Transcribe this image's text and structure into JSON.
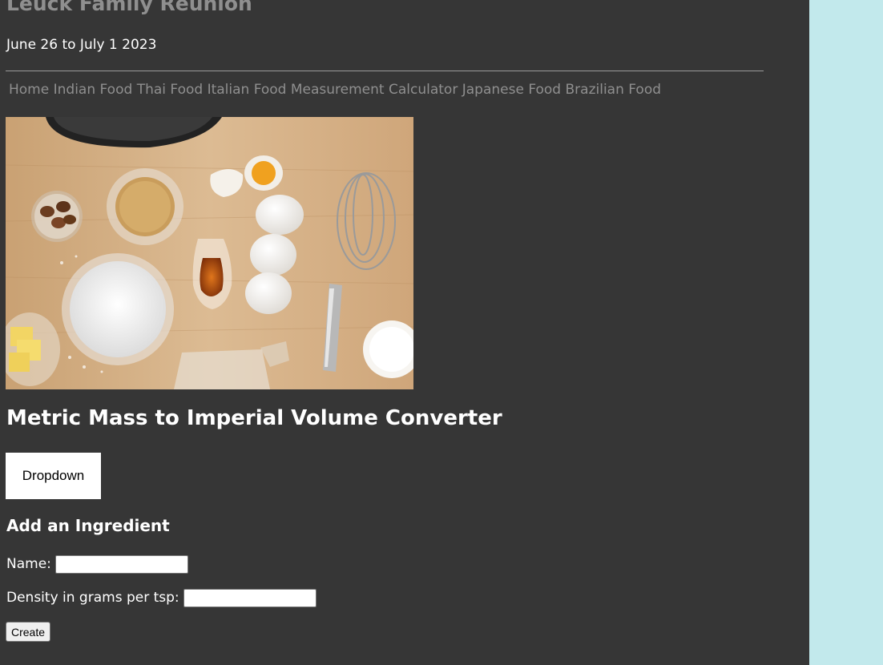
{
  "site": {
    "title": "Leuck Family Reunion",
    "dates": "June 26 to July 1 2023"
  },
  "nav": {
    "items": [
      {
        "label": "Home"
      },
      {
        "label": "Indian Food"
      },
      {
        "label": "Thai Food"
      },
      {
        "label": "Italian Food"
      },
      {
        "label": "Measurement Calculator"
      },
      {
        "label": "Japanese Food"
      },
      {
        "label": "Brazilian Food"
      }
    ]
  },
  "converter": {
    "title": "Metric Mass to Imperial Volume Converter",
    "dropdown_label": "Dropdown"
  },
  "ingredient_form": {
    "title": "Add an Ingredient",
    "name_label": "Name:",
    "name_value": "",
    "density_label": "Density in grams per tsp:",
    "density_value": "",
    "create_label": "Create"
  },
  "colors": {
    "page_background": "#363636",
    "outer_background": "#c2e9ec",
    "muted_text": "#8f8f8f",
    "text": "#ffffff"
  }
}
